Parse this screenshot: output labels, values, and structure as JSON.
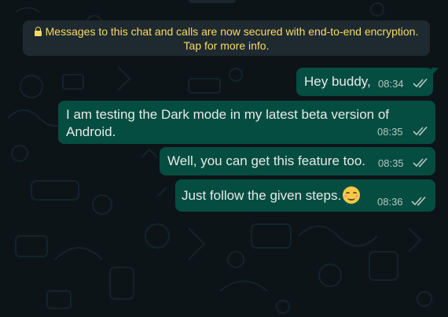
{
  "chat": {
    "encryption_notice": {
      "line1": "Messages to this chat and calls are now secured with end-to-end encryption.",
      "line2": "Tap for more info.",
      "icon": "lock-icon",
      "color": "#fad964"
    },
    "messages": [
      {
        "text": "Hey buddy,",
        "time": "08:34",
        "status": "read-double-tick"
      },
      {
        "text": "I am testing the Dark mode in my latest beta version of Android.",
        "time": "08:35",
        "status": "read-double-tick"
      },
      {
        "text": "Well, you can get this feature too.",
        "time": "08:35",
        "status": "read-double-tick"
      },
      {
        "text": "Just follow the given steps.",
        "emoji": "smiling-face-emoji",
        "time": "08:36",
        "status": "read-double-tick"
      }
    ]
  },
  "colors": {
    "background": "#0d1418",
    "outgoing_bubble": "#054d40",
    "banner_bg": "#1e2a30"
  }
}
